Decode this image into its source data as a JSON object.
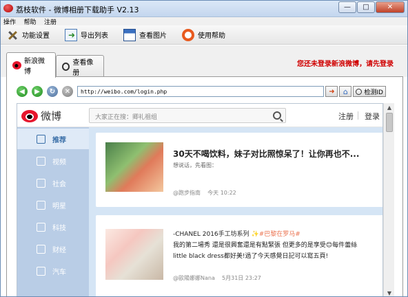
{
  "window": {
    "title": "荔枝软件 - 微博相册下载助手 V2.13",
    "controls": {
      "minimize": "—",
      "maximize": "□",
      "close": "✕"
    }
  },
  "menu": [
    "操作",
    "帮助",
    "注册"
  ],
  "toolbar": [
    {
      "label": "功能设置",
      "icon": "settings-tools-icon"
    },
    {
      "label": "导出列表",
      "icon": "export-list-icon"
    },
    {
      "label": "查看图片",
      "icon": "view-images-icon"
    },
    {
      "label": "使用帮助",
      "icon": "help-lifebuoy-icon"
    }
  ],
  "tabs": [
    {
      "label": "新浪微博",
      "icon": "weibo-icon",
      "active": true
    },
    {
      "label": "查看像册",
      "icon": "magnifier-icon",
      "active": false
    }
  ],
  "login_notice": "您还未登录新浪微博，请先登录",
  "browser": {
    "url": "http://weibo.com/login.php",
    "detect_label": "检测ID"
  },
  "weibo": {
    "logo_text": "微博",
    "search_placeholder": "大家正在搜：卿礼祖组",
    "register": "注册",
    "login": "登录",
    "nav": [
      "推荐",
      "视频",
      "社会",
      "明星",
      "科技",
      "财经",
      "汽车"
    ],
    "posts": [
      {
        "title": "30天不喝饮料，妹子对比照惊呆了！让你再也不...",
        "meta": "想说话，先看图：",
        "author": "@跑步指南",
        "time": "今天 10:22"
      },
      {
        "line1_prefix": "-CHANEL 2016手工坊系列",
        "line1_tag": "✨#巴黎在罗马#",
        "line2": "我的第二場秀 還是很興奮還是有點緊張  但更多的是享受😊每件蕾絲",
        "line3": "little black dress都好美!過了今天感覺日記可以寫五頁!",
        "author": "@歐陽娜娜Nana",
        "time": "5月31日 23:27"
      }
    ]
  },
  "colors": {
    "weibo_red": "#e6162d",
    "notice_red": "#d00000",
    "sidebar_blue": "#b9cde6"
  }
}
